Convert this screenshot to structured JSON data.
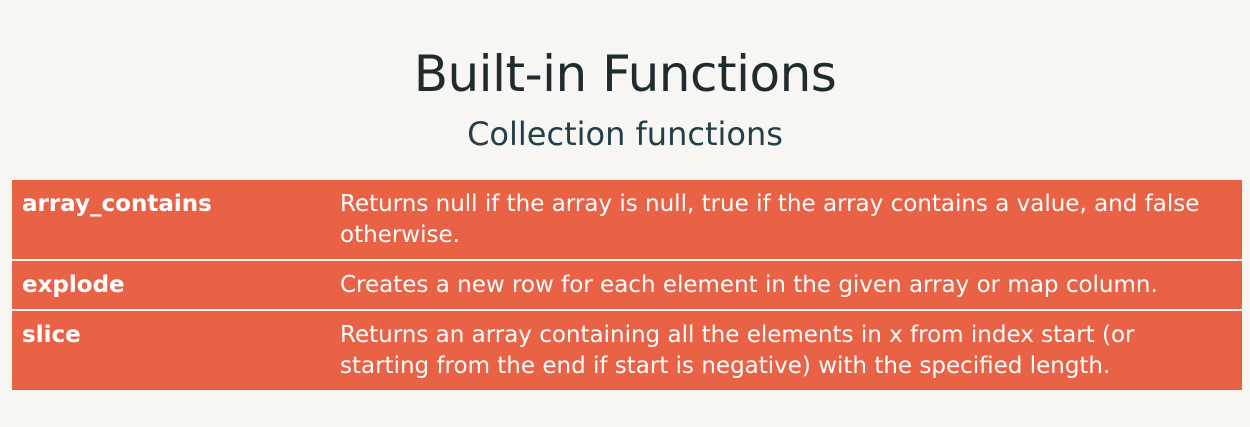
{
  "slide": {
    "title": "Built-in Functions",
    "subtitle": "Collection functions",
    "accent_color": "#ea6246",
    "background_color": "#f7f6f2"
  },
  "functions": [
    {
      "name": "array_contains",
      "description": "Returns null if the array is null, true if the array contains a value, and false otherwise."
    },
    {
      "name": "explode",
      "description": "Creates a new row for each element in the given array or map column."
    },
    {
      "name": "slice",
      "description": "Returns an array containing all the elements in x from index start (or starting from the end if start is negative) with the specified length."
    }
  ]
}
